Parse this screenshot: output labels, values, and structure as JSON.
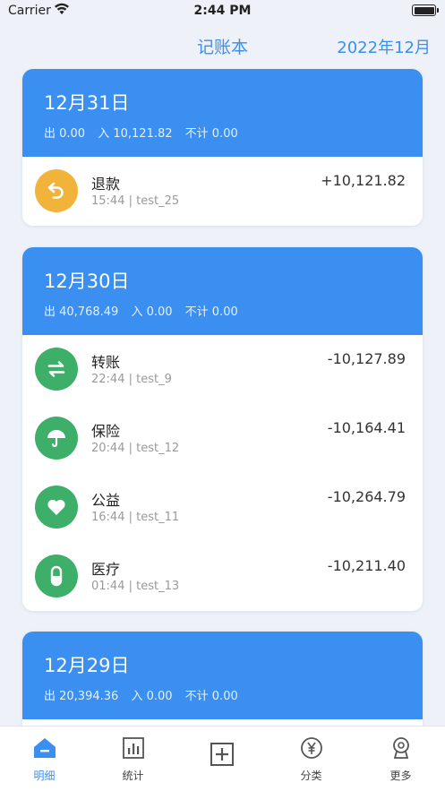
{
  "status_bar": {
    "carrier": "Carrier",
    "time": "2:44 PM"
  },
  "header": {
    "title": "记账本",
    "period": "2022年12月"
  },
  "days": [
    {
      "date": "12月31日",
      "out": "出 0.00",
      "in": "入 10,121.82",
      "excluded": "不计 0.00",
      "items": [
        {
          "name": "退款",
          "meta": "15:44 | test_25",
          "amount": "+10,121.82",
          "icon": "refund-icon",
          "color": "#f2b33a"
        }
      ]
    },
    {
      "date": "12月30日",
      "out": "出 40,768.49",
      "in": "入 0.00",
      "excluded": "不计 0.00",
      "items": [
        {
          "name": "转账",
          "meta": "22:44 | test_9",
          "amount": "-10,127.89",
          "icon": "transfer-icon",
          "color": "#3daf68"
        },
        {
          "name": "保险",
          "meta": "20:44 | test_12",
          "amount": "-10,164.41",
          "icon": "umbrella-icon",
          "color": "#3daf68"
        },
        {
          "name": "公益",
          "meta": "16:44 | test_11",
          "amount": "-10,264.79",
          "icon": "heart-icon",
          "color": "#3daf68"
        },
        {
          "name": "医疗",
          "meta": "01:44 | test_13",
          "amount": "-10,211.40",
          "icon": "pill-icon",
          "color": "#3daf68"
        }
      ]
    },
    {
      "date": "12月29日",
      "out": "出 20,394.36",
      "in": "入 0.00",
      "excluded": "不计 0.00",
      "items": []
    }
  ],
  "tabs": [
    {
      "label": "明细",
      "icon": "home-icon",
      "active": true
    },
    {
      "label": "统计",
      "icon": "chart-icon",
      "active": false
    },
    {
      "label": "",
      "icon": "add-icon",
      "active": false
    },
    {
      "label": "分类",
      "icon": "yen-icon",
      "active": false
    },
    {
      "label": "更多",
      "icon": "more-icon",
      "active": false
    }
  ],
  "colors": {
    "accent": "#3a8ff0",
    "expense_green": "#3daf68",
    "refund_yellow": "#f2b33a"
  }
}
